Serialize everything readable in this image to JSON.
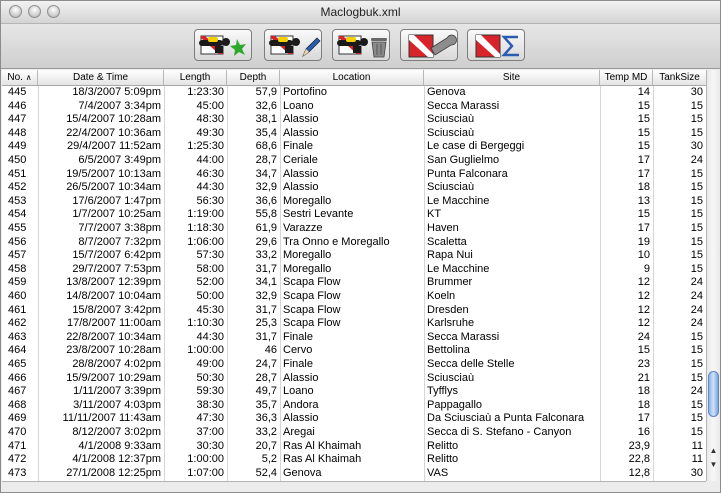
{
  "window": {
    "title": "Maclogbuk.xml"
  },
  "toolbar": {
    "buttons": [
      {
        "name": "new-dive",
        "icon": "diver-flag-star-icon"
      },
      {
        "name": "edit-dive",
        "icon": "diver-flag-pencil-icon"
      },
      {
        "name": "delete-dive",
        "icon": "diver-flag-trash-icon"
      },
      {
        "name": "tools",
        "icon": "dive-flag-wrench-icon"
      },
      {
        "name": "statistics",
        "icon": "dive-flag-sigma-icon"
      }
    ]
  },
  "colors": {
    "dive_flag_red": "#d8232a",
    "accent_blue": "#2a5db0",
    "diver_yellow": "#f0d000",
    "leaf_green": "#2ca82c"
  },
  "table": {
    "headers": [
      "No.",
      "Date & Time",
      "Length",
      "Depth",
      "Location",
      "Site",
      "Temp MD",
      "TankSize"
    ],
    "sort_indicator": "∧",
    "rows": [
      [
        "445",
        "18/3/2007 5:09pm",
        "1:23:30",
        "57,9",
        "Portofino",
        "Genova",
        "14",
        "30"
      ],
      [
        "446",
        "7/4/2007 3:34pm",
        "45:00",
        "32,6",
        "Loano",
        "Secca Marassi",
        "15",
        "15"
      ],
      [
        "447",
        "15/4/2007 10:28am",
        "48:30",
        "38,1",
        "Alassio",
        "Sciusciaù",
        "15",
        "15"
      ],
      [
        "448",
        "22/4/2007 10:36am",
        "49:30",
        "35,4",
        "Alassio",
        "Sciusciaù",
        "15",
        "15"
      ],
      [
        "449",
        "29/4/2007 11:52am",
        "1:25:30",
        "68,6",
        "Finale",
        "Le case di Bergeggi",
        "15",
        "30"
      ],
      [
        "450",
        "6/5/2007 3:49pm",
        "44:00",
        "28,7",
        "Ceriale",
        "San Guglielmo",
        "17",
        "24"
      ],
      [
        "451",
        "19/5/2007 10:13am",
        "46:30",
        "34,7",
        "Alassio",
        "Punta Falconara",
        "17",
        "15"
      ],
      [
        "452",
        "26/5/2007 10:34am",
        "44:30",
        "32,9",
        "Alassio",
        "Sciusciaù",
        "18",
        "15"
      ],
      [
        "453",
        "17/6/2007 1:47pm",
        "56:30",
        "36,6",
        "Moregallo",
        "Le Macchine",
        "13",
        "15"
      ],
      [
        "454",
        "1/7/2007 10:25am",
        "1:19:00",
        "55,8",
        "Sestri Levante",
        "KT",
        "15",
        "15"
      ],
      [
        "455",
        "7/7/2007 3:38pm",
        "1:18:30",
        "61,9",
        "Varazze",
        "Haven",
        "17",
        "15"
      ],
      [
        "456",
        "8/7/2007 7:32pm",
        "1:06:00",
        "29,6",
        "Tra Onno e Moregallo",
        "Scaletta",
        "19",
        "15"
      ],
      [
        "457",
        "15/7/2007 6:42pm",
        "57:30",
        "33,2",
        "Moregallo",
        "Rapa Nui",
        "10",
        "15"
      ],
      [
        "458",
        "29/7/2007 7:53pm",
        "58:00",
        "31,7",
        "Moregallo",
        "Le Macchine",
        "9",
        "15"
      ],
      [
        "459",
        "13/8/2007 12:39pm",
        "52:00",
        "34,1",
        "Scapa Flow",
        "Brummer",
        "12",
        "24"
      ],
      [
        "460",
        "14/8/2007 10:04am",
        "50:00",
        "32,9",
        "Scapa Flow",
        "Koeln",
        "12",
        "24"
      ],
      [
        "461",
        "15/8/2007 3:42pm",
        "45:30",
        "31,7",
        "Scapa Flow",
        "Dresden",
        "12",
        "24"
      ],
      [
        "462",
        "17/8/2007 11:00am",
        "1:10:30",
        "25,3",
        "Scapa Flow",
        "Karlsruhe",
        "12",
        "24"
      ],
      [
        "463",
        "22/8/2007 10:34am",
        "44:30",
        "31,7",
        "Finale",
        "Secca Marassi",
        "24",
        "15"
      ],
      [
        "464",
        "23/8/2007 10:28am",
        "1:00:00",
        "46",
        "Cervo",
        "Bettolina",
        "15",
        "15"
      ],
      [
        "465",
        "28/8/2007 4:02pm",
        "49:00",
        "24,7",
        "Finale",
        "Secca delle Stelle",
        "23",
        "15"
      ],
      [
        "466",
        "15/9/2007 10:29am",
        "50:30",
        "28,7",
        "Alassio",
        "Sciusciaù",
        "21",
        "15"
      ],
      [
        "467",
        "1/11/2007 3:39pm",
        "59:30",
        "49,7",
        "Loano",
        "Tyfflys",
        "18",
        "24"
      ],
      [
        "468",
        "3/11/2007 4:03pm",
        "38:30",
        "35,7",
        "Andora",
        "Pappagallo",
        "18",
        "15"
      ],
      [
        "469",
        "11/11/2007 11:43am",
        "47:30",
        "36,3",
        "Alassio",
        "Da Sciusciaù a Punta Falconara",
        "17",
        "15"
      ],
      [
        "470",
        "8/12/2007 3:02pm",
        "37:00",
        "33,2",
        "Aregai",
        "Secca di S. Stefano - Canyon",
        "16",
        "15"
      ],
      [
        "471",
        "4/1/2008 9:33am",
        "30:30",
        "20,7",
        "Ras Al Khaimah",
        "Relitto",
        "23,9",
        "11"
      ],
      [
        "472",
        "4/1/2008 12:37pm",
        "1:00:00",
        "5,2",
        "Ras Al Khaimah",
        "Relitto",
        "22,8",
        "11"
      ],
      [
        "473",
        "27/1/2008 12:25pm",
        "1:07:00",
        "52,4",
        "Genova",
        "VAS",
        "12,8",
        "30"
      ]
    ]
  },
  "scroll": {
    "vertical_position": 0.93
  }
}
